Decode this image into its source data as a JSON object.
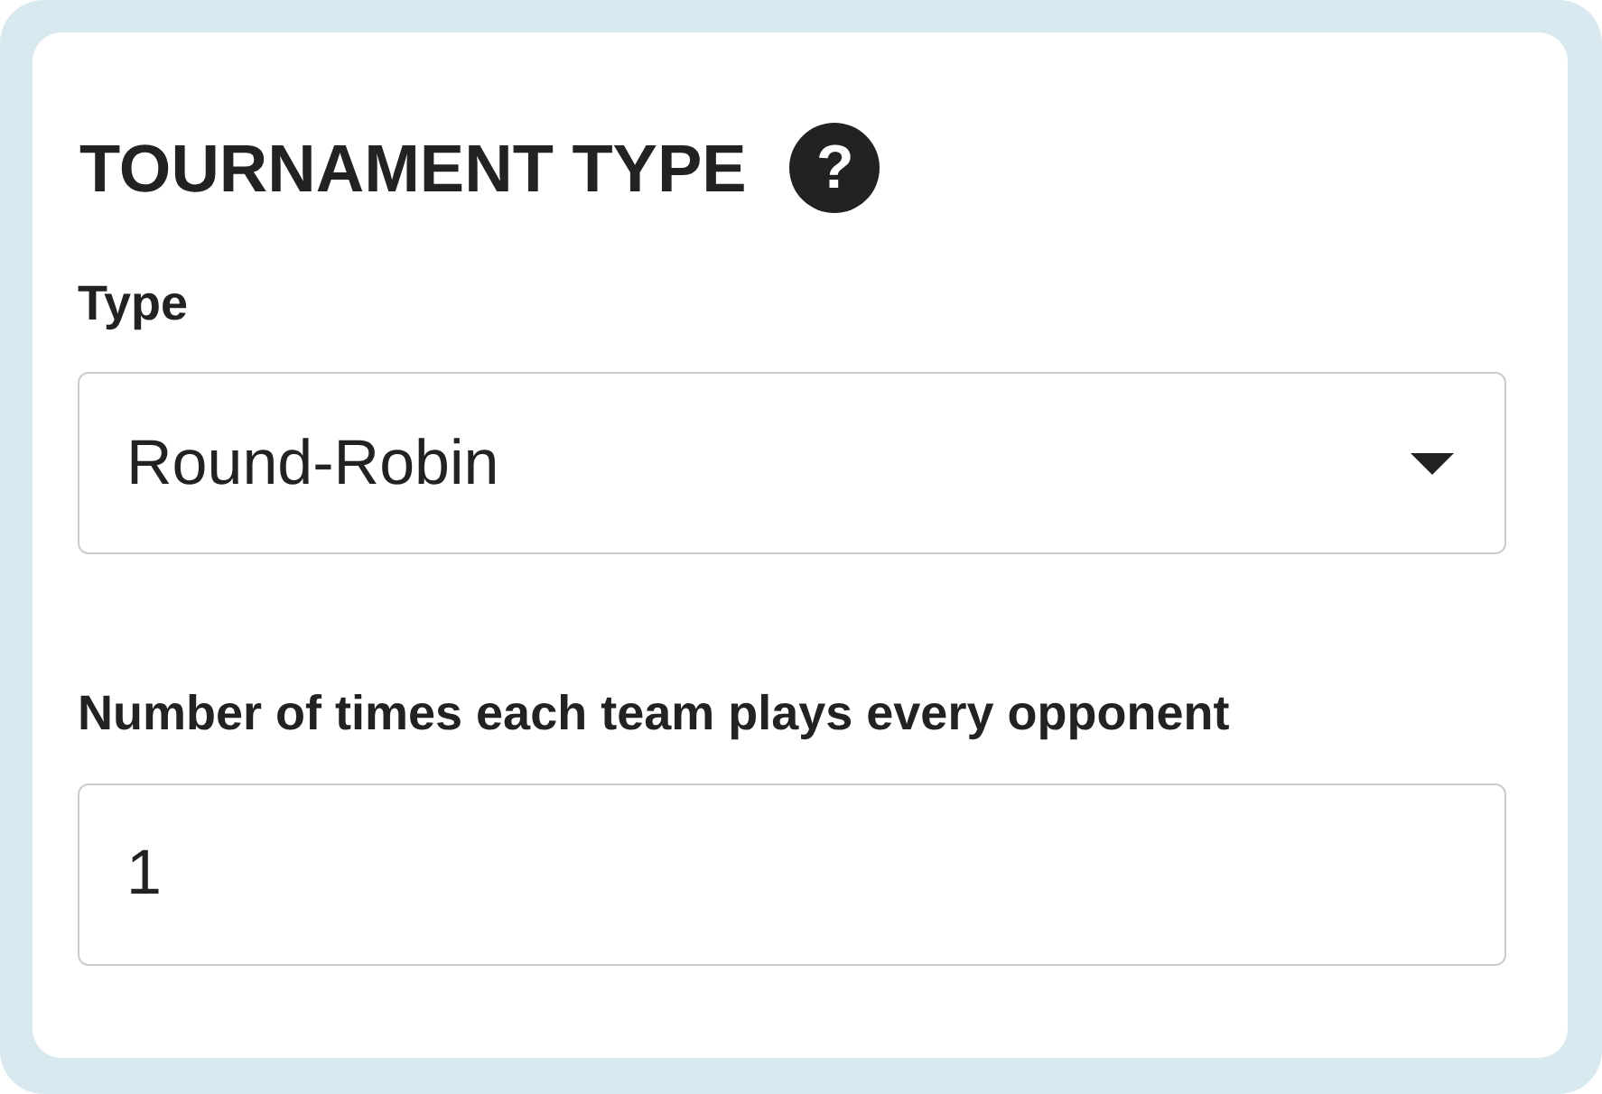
{
  "section": {
    "title": "TOURNAMENT TYPE",
    "help_icon": "?"
  },
  "fields": [
    {
      "kind": "select",
      "label": "Type",
      "value": "Round-Robin"
    },
    {
      "kind": "input",
      "label": "Number of times each team plays every opponent",
      "value": "1"
    }
  ]
}
